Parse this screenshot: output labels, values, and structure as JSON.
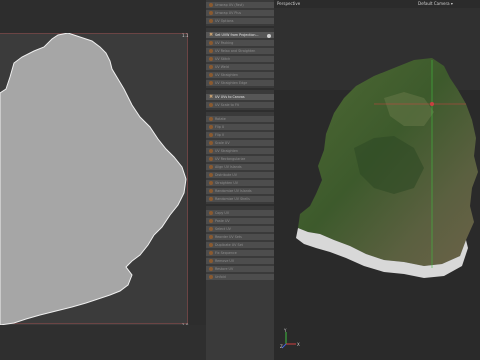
{
  "uv_editor": {
    "tick_top_right": "1.1",
    "tick_bottom_right": "1.0",
    "colors": {
      "canvas": "#3b3b3b",
      "shape_fill": "#a6a6a6",
      "shape_edge": "#f0f0f0",
      "grid": "#6b4444"
    }
  },
  "menu": {
    "items": [
      {
        "label": "Unwrap UV (Fast)",
        "active": false
      },
      {
        "label": "Unwrap UV Plus",
        "active": false
      },
      {
        "label": "UV Options",
        "active": false
      },
      {
        "label": "Set UVW from Projection...",
        "active": true,
        "icon": "cross-icon"
      },
      {
        "label": "UV Packing",
        "active": false
      },
      {
        "label": "UV Relax and Straighten",
        "active": false
      },
      {
        "label": "UV Stitch",
        "active": false
      },
      {
        "label": "UV Weld",
        "active": false
      },
      {
        "label": "UV Straighten",
        "active": false
      },
      {
        "label": "UV Straighten Edge",
        "active": false
      },
      {
        "label": "UV UVs to Canvas",
        "active": true,
        "icon": "cross-icon"
      },
      {
        "label": "UV Scale to Fit",
        "active": false
      },
      {
        "label": "Rotate",
        "active": false
      },
      {
        "label": "Flip U",
        "active": false
      },
      {
        "label": "Flip V",
        "active": false
      },
      {
        "label": "Scale UV",
        "active": false
      },
      {
        "label": "UV Straighten",
        "active": false
      },
      {
        "label": "UV Rectangularize",
        "active": false
      },
      {
        "label": "Align UV Islands",
        "active": false
      },
      {
        "label": "Distribute UV",
        "active": false
      },
      {
        "label": "Straighten UV",
        "active": false
      },
      {
        "label": "Randomize UV Islands",
        "active": false
      },
      {
        "label": "Randomize UV Shells",
        "active": false
      },
      {
        "label": "Copy UV",
        "active": false
      },
      {
        "label": "Paste UV",
        "active": false
      },
      {
        "label": "Select UV",
        "active": false
      },
      {
        "label": "Reorder UV Sets",
        "active": false
      },
      {
        "label": "Duplicate UV Set",
        "active": false
      },
      {
        "label": "Fix Sequence",
        "active": false
      },
      {
        "label": "Remove UV",
        "active": false
      },
      {
        "label": "Restore UV",
        "active": false
      },
      {
        "label": "Unfold",
        "active": false
      }
    ]
  },
  "viewport": {
    "title": "Perspective",
    "camera": "Default Camera",
    "camera_icon": "camera-dropdown-icon",
    "axes": {
      "x": "X",
      "y": "Y",
      "z": "Z"
    },
    "colors": {
      "bg": "#303030",
      "floor": "#2a2a2a",
      "gizmo_x": "#d04040",
      "gizmo_y": "#40c040",
      "gizmo_z": "#4060e0"
    }
  }
}
